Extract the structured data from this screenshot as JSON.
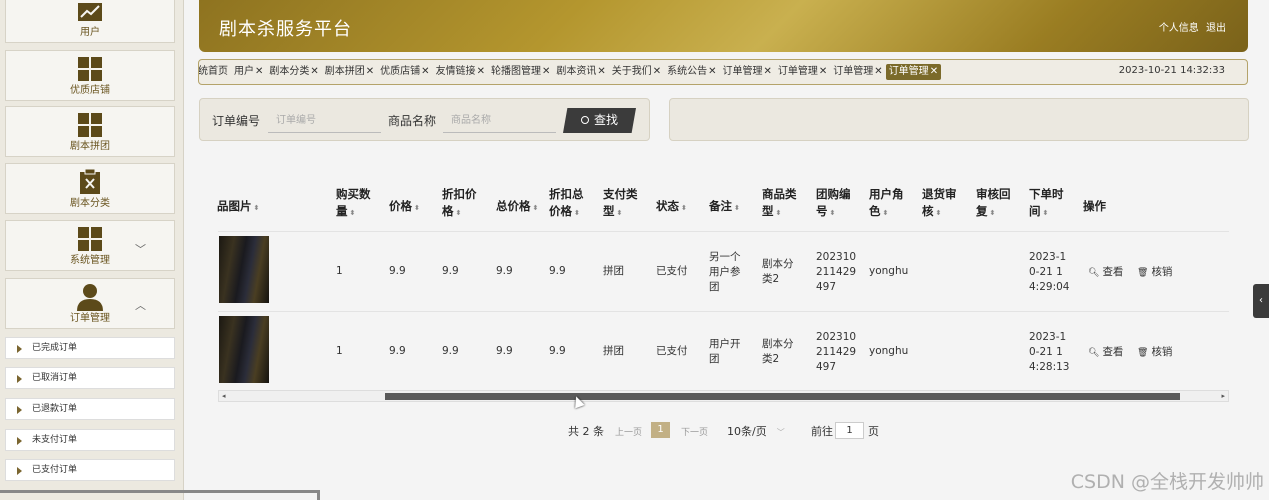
{
  "app": {
    "title": "剧本杀服务平台",
    "header_links": [
      "个人信息",
      "退出"
    ]
  },
  "sidebar": {
    "items": [
      {
        "label": "用户",
        "icon": "chart-line-icon"
      },
      {
        "label": "优质店铺",
        "icon": "grid-icon"
      },
      {
        "label": "剧本拼团",
        "icon": "grid-icon"
      },
      {
        "label": "剧本分类",
        "icon": "clipboard-x-icon"
      },
      {
        "label": "系统管理",
        "icon": "grid-icon"
      },
      {
        "label": "订单管理",
        "icon": "user-icon"
      }
    ],
    "sub_items": [
      "已完成订单",
      "已取消订单",
      "已退款订单",
      "未支付订单",
      "已支付订单"
    ]
  },
  "tabs": {
    "items": [
      {
        "label": "统首页",
        "closable": false
      },
      {
        "label": "用户",
        "closable": true
      },
      {
        "label": "剧本分类",
        "closable": true
      },
      {
        "label": "剧本拼团",
        "closable": true
      },
      {
        "label": "优质店铺",
        "closable": true
      },
      {
        "label": "友情链接",
        "closable": true
      },
      {
        "label": "轮播图管理",
        "closable": true
      },
      {
        "label": "剧本资讯",
        "closable": true
      },
      {
        "label": "关于我们",
        "closable": true
      },
      {
        "label": "系统公告",
        "closable": true
      },
      {
        "label": "订单管理",
        "closable": true
      },
      {
        "label": "订单管理",
        "closable": true
      },
      {
        "label": "订单管理",
        "closable": true
      },
      {
        "label": "订单管理",
        "closable": true,
        "active": true
      }
    ],
    "close_glyph": "✕",
    "datetime": "2023-10-21 14:32:33"
  },
  "search": {
    "order_no_label": "订单编号",
    "order_no_placeholder": "订单编号",
    "product_name_label": "商品名称",
    "product_name_placeholder": "商品名称",
    "search_button": "查找"
  },
  "table": {
    "headers": [
      [
        "品图片"
      ],
      [
        "购买数",
        "量"
      ],
      [
        "价格"
      ],
      [
        "折扣价",
        "格"
      ],
      [
        "总价格"
      ],
      [
        "折扣总",
        "价格"
      ],
      [
        "支付类",
        "型"
      ],
      [
        "状态"
      ],
      [
        "备注"
      ],
      [
        "商品类",
        "型"
      ],
      [
        "团购编",
        "号"
      ],
      [
        "用户角",
        "色"
      ],
      [
        "退货审",
        "核"
      ],
      [
        "审核回",
        "复"
      ],
      [
        "下单时",
        "间"
      ],
      [
        "操作"
      ]
    ],
    "rows": [
      {
        "qty": "1",
        "price": "9.9",
        "discount_price": "9.9",
        "total": "9.9",
        "discount_total": "9.9",
        "pay_type": "拼团",
        "status": "已支付",
        "remark": [
          "另一个",
          "用户参",
          "团"
        ],
        "category": [
          "剧本分",
          "类2"
        ],
        "group_no": [
          "202310",
          "211429",
          "497"
        ],
        "role": "yonghu",
        "order_time": [
          "2023-1",
          "0-21 1",
          "4:29:04"
        ]
      },
      {
        "qty": "1",
        "price": "9.9",
        "discount_price": "9.9",
        "total": "9.9",
        "discount_total": "9.9",
        "pay_type": "拼团",
        "status": "已支付",
        "remark": [
          "用户开",
          "团"
        ],
        "category": [
          "剧本分",
          "类2"
        ],
        "group_no": [
          "202310",
          "211429",
          "497"
        ],
        "role": "yonghu",
        "order_time": [
          "2023-1",
          "0-21 1",
          "4:28:13"
        ]
      }
    ],
    "actions": {
      "view": "查看",
      "verify": "核销"
    }
  },
  "pager": {
    "total": "共 2 条",
    "prev": "上一页",
    "current": "1",
    "next": "下一页",
    "page_size": "10条/页",
    "goto_prefix": "前往",
    "goto_value": "1",
    "goto_suffix": "页"
  },
  "watermark": "CSDN @全栈开发帅帅",
  "colors": {
    "brand": "#9a7d22",
    "active_tab": "#7b6a2a",
    "button": "#3b3b3b"
  }
}
